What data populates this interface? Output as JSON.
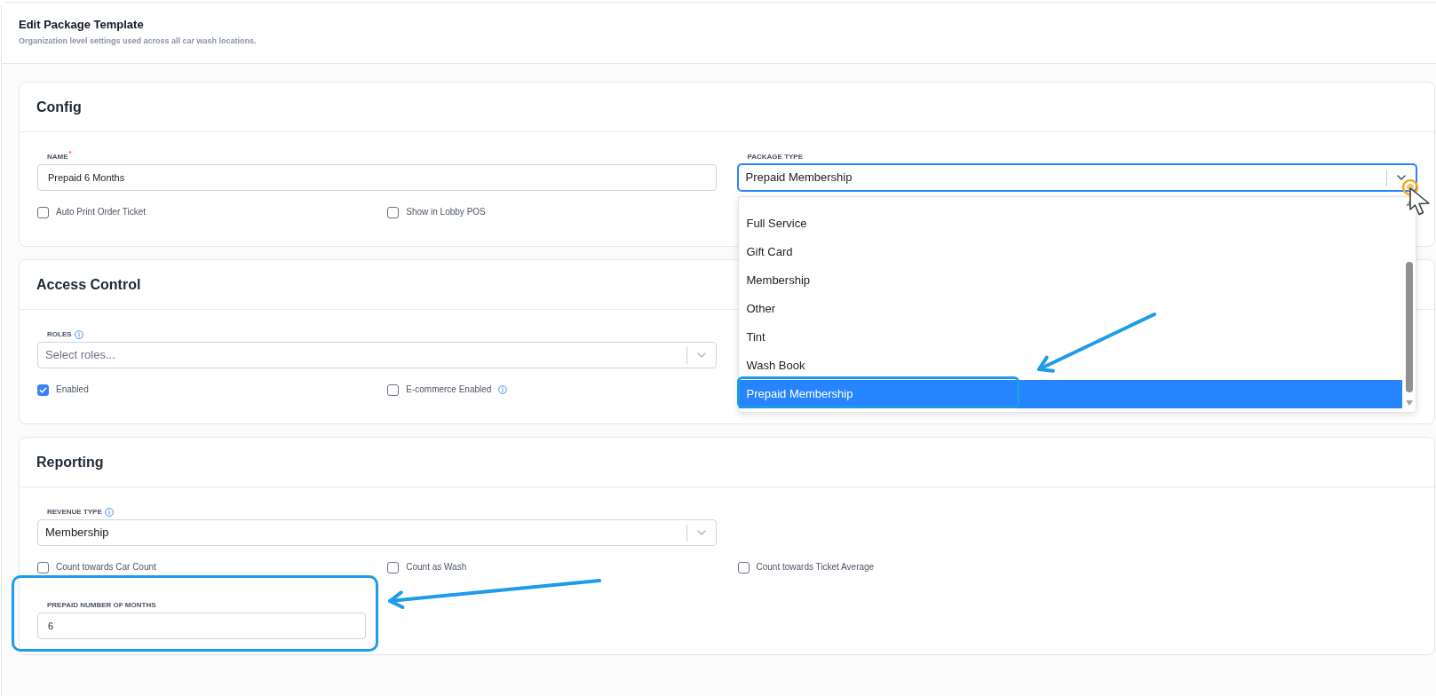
{
  "page": {
    "title": "Edit Package Template",
    "subtitle": "Organization level settings used across all car wash locations."
  },
  "sections": [
    {
      "title": "Config",
      "items": [
        {
          "kind": "text",
          "label": "NAME",
          "required_mark": "*",
          "value": "Prepaid 6 Months"
        },
        {
          "kind": "select",
          "label": "PACKAGE TYPE",
          "value": "Prepaid Membership",
          "focused": true,
          "expanded": true,
          "options": [
            {
              "label": "Full Service",
              "selected": false
            },
            {
              "label": "Gift Card",
              "selected": false
            },
            {
              "label": "Membership",
              "selected": false
            },
            {
              "label": "Other",
              "selected": false
            },
            {
              "label": "Tint",
              "selected": false
            },
            {
              "label": "Wash Book",
              "selected": false
            },
            {
              "label": "Prepaid Membership",
              "selected": true,
              "highlighted": true
            }
          ]
        },
        {
          "kind": "checkbox",
          "label": "Auto Print Order Ticket",
          "checked": false
        },
        {
          "kind": "checkbox",
          "label": "Show in Lobby POS",
          "checked": false
        }
      ]
    },
    {
      "title": "Access Control",
      "items": [
        {
          "kind": "select",
          "label": "ROLES",
          "info": true,
          "placeholder": "Select roles..."
        },
        {
          "kind": "checkbox",
          "label": "Enabled",
          "checked": true
        },
        {
          "kind": "checkbox",
          "label": "E-commerce Enabled",
          "checked": false,
          "info": true
        }
      ]
    },
    {
      "title": "Reporting",
      "items": [
        {
          "kind": "select",
          "label": "REVENUE TYPE",
          "info": true,
          "value": "Membership"
        },
        {
          "kind": "checkbox",
          "label": "Count towards Car Count",
          "checked": false
        },
        {
          "kind": "checkbox",
          "label": "Count as Wash",
          "checked": false
        },
        {
          "kind": "checkbox",
          "label": "Count towards Ticket Average",
          "checked": false
        },
        {
          "kind": "number",
          "label": "PREPAID NUMBER OF MONTHS",
          "value": "6",
          "highlighted": true
        }
      ]
    }
  ]
}
